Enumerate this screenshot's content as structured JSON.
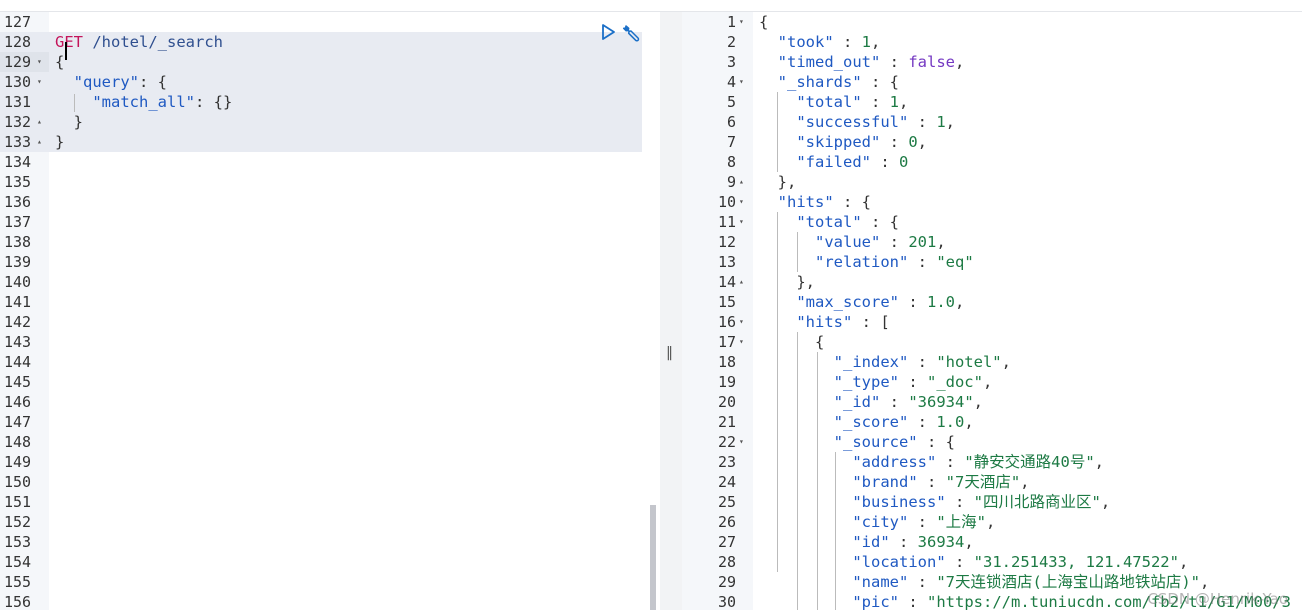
{
  "request_editor": {
    "lines": [
      {
        "n": "127",
        "html": ""
      },
      {
        "n": "128",
        "method": "GET",
        "path": "/hotel/_search"
      },
      {
        "n": "129",
        "fold": "▾",
        "code": "{",
        "tokens": [
          [
            "punc",
            "{"
          ]
        ]
      },
      {
        "n": "130",
        "fold": "▾",
        "tokens": [
          [
            "punc",
            "  "
          ],
          [
            "key",
            "\"query\""
          ],
          [
            "punc",
            ": {"
          ]
        ]
      },
      {
        "n": "131",
        "tokens": [
          [
            "punc",
            "    "
          ],
          [
            "key",
            "\"match_all\""
          ],
          [
            "punc",
            ": {}"
          ]
        ]
      },
      {
        "n": "132",
        "fold": "▴",
        "tokens": [
          [
            "punc",
            "  }"
          ]
        ]
      },
      {
        "n": "133",
        "fold": "▴",
        "tokens": [
          [
            "punc",
            "}"
          ]
        ]
      },
      {
        "n": "134"
      },
      {
        "n": "135"
      },
      {
        "n": "136"
      },
      {
        "n": "137"
      },
      {
        "n": "138"
      },
      {
        "n": "139"
      },
      {
        "n": "140"
      },
      {
        "n": "141"
      },
      {
        "n": "142"
      },
      {
        "n": "143"
      },
      {
        "n": "144"
      },
      {
        "n": "145"
      },
      {
        "n": "146"
      },
      {
        "n": "147"
      },
      {
        "n": "148"
      },
      {
        "n": "149"
      },
      {
        "n": "150"
      },
      {
        "n": "151"
      },
      {
        "n": "152"
      },
      {
        "n": "153"
      },
      {
        "n": "154"
      },
      {
        "n": "155"
      },
      {
        "n": "156"
      }
    ],
    "run_icon": "play-icon",
    "settings_icon": "wrench-icon"
  },
  "splitter": {
    "glyph": "‖"
  },
  "response_viewer": {
    "lines": [
      {
        "n": "1",
        "fold": "▾",
        "tokens": [
          [
            "punc",
            "{"
          ]
        ]
      },
      {
        "n": "2",
        "tokens": [
          [
            "punc",
            "  "
          ],
          [
            "key",
            "\"took\""
          ],
          [
            "punc",
            " : "
          ],
          [
            "num",
            "1"
          ],
          [
            "punc",
            ","
          ]
        ]
      },
      {
        "n": "3",
        "tokens": [
          [
            "punc",
            "  "
          ],
          [
            "key",
            "\"timed_out\""
          ],
          [
            "punc",
            " : "
          ],
          [
            "bool",
            "false"
          ],
          [
            "punc",
            ","
          ]
        ]
      },
      {
        "n": "4",
        "fold": "▾",
        "tokens": [
          [
            "punc",
            "  "
          ],
          [
            "key",
            "\"_shards\""
          ],
          [
            "punc",
            " : {"
          ]
        ]
      },
      {
        "n": "5",
        "tokens": [
          [
            "punc",
            "    "
          ],
          [
            "key",
            "\"total\""
          ],
          [
            "punc",
            " : "
          ],
          [
            "num",
            "1"
          ],
          [
            "punc",
            ","
          ]
        ]
      },
      {
        "n": "6",
        "tokens": [
          [
            "punc",
            "    "
          ],
          [
            "key",
            "\"successful\""
          ],
          [
            "punc",
            " : "
          ],
          [
            "num",
            "1"
          ],
          [
            "punc",
            ","
          ]
        ]
      },
      {
        "n": "7",
        "tokens": [
          [
            "punc",
            "    "
          ],
          [
            "key",
            "\"skipped\""
          ],
          [
            "punc",
            " : "
          ],
          [
            "num",
            "0"
          ],
          [
            "punc",
            ","
          ]
        ]
      },
      {
        "n": "8",
        "tokens": [
          [
            "punc",
            "    "
          ],
          [
            "key",
            "\"failed\""
          ],
          [
            "punc",
            " : "
          ],
          [
            "num",
            "0"
          ]
        ]
      },
      {
        "n": "9",
        "fold": "▴",
        "tokens": [
          [
            "punc",
            "  },"
          ]
        ]
      },
      {
        "n": "10",
        "fold": "▾",
        "tokens": [
          [
            "punc",
            "  "
          ],
          [
            "key",
            "\"hits\""
          ],
          [
            "punc",
            " : {"
          ]
        ]
      },
      {
        "n": "11",
        "fold": "▾",
        "tokens": [
          [
            "punc",
            "    "
          ],
          [
            "key",
            "\"total\""
          ],
          [
            "punc",
            " : {"
          ]
        ]
      },
      {
        "n": "12",
        "tokens": [
          [
            "punc",
            "      "
          ],
          [
            "key",
            "\"value\""
          ],
          [
            "punc",
            " : "
          ],
          [
            "num",
            "201"
          ],
          [
            "punc",
            ","
          ]
        ]
      },
      {
        "n": "13",
        "tokens": [
          [
            "punc",
            "      "
          ],
          [
            "key",
            "\"relation\""
          ],
          [
            "punc",
            " : "
          ],
          [
            "str",
            "\"eq\""
          ]
        ]
      },
      {
        "n": "14",
        "fold": "▴",
        "tokens": [
          [
            "punc",
            "    },"
          ]
        ]
      },
      {
        "n": "15",
        "tokens": [
          [
            "punc",
            "    "
          ],
          [
            "key",
            "\"max_score\""
          ],
          [
            "punc",
            " : "
          ],
          [
            "num",
            "1.0"
          ],
          [
            "punc",
            ","
          ]
        ]
      },
      {
        "n": "16",
        "fold": "▾",
        "tokens": [
          [
            "punc",
            "    "
          ],
          [
            "key",
            "\"hits\""
          ],
          [
            "punc",
            " : ["
          ]
        ]
      },
      {
        "n": "17",
        "fold": "▾",
        "tokens": [
          [
            "punc",
            "      {"
          ]
        ]
      },
      {
        "n": "18",
        "tokens": [
          [
            "punc",
            "        "
          ],
          [
            "key",
            "\"_index\""
          ],
          [
            "punc",
            " : "
          ],
          [
            "str",
            "\"hotel\""
          ],
          [
            "punc",
            ","
          ]
        ]
      },
      {
        "n": "19",
        "tokens": [
          [
            "punc",
            "        "
          ],
          [
            "key",
            "\"_type\""
          ],
          [
            "punc",
            " : "
          ],
          [
            "str",
            "\"_doc\""
          ],
          [
            "punc",
            ","
          ]
        ]
      },
      {
        "n": "20",
        "tokens": [
          [
            "punc",
            "        "
          ],
          [
            "key",
            "\"_id\""
          ],
          [
            "punc",
            " : "
          ],
          [
            "str",
            "\"36934\""
          ],
          [
            "punc",
            ","
          ]
        ]
      },
      {
        "n": "21",
        "tokens": [
          [
            "punc",
            "        "
          ],
          [
            "key",
            "\"_score\""
          ],
          [
            "punc",
            " : "
          ],
          [
            "num",
            "1.0"
          ],
          [
            "punc",
            ","
          ]
        ]
      },
      {
        "n": "22",
        "fold": "▾",
        "tokens": [
          [
            "punc",
            "        "
          ],
          [
            "key",
            "\"_source\""
          ],
          [
            "punc",
            " : {"
          ]
        ]
      },
      {
        "n": "23",
        "tokens": [
          [
            "punc",
            "          "
          ],
          [
            "key",
            "\"address\""
          ],
          [
            "punc",
            " : "
          ],
          [
            "str",
            "\"静安交通路40号\""
          ],
          [
            "punc",
            ","
          ]
        ]
      },
      {
        "n": "24",
        "tokens": [
          [
            "punc",
            "          "
          ],
          [
            "key",
            "\"brand\""
          ],
          [
            "punc",
            " : "
          ],
          [
            "str",
            "\"7天酒店\""
          ],
          [
            "punc",
            ","
          ]
        ]
      },
      {
        "n": "25",
        "tokens": [
          [
            "punc",
            "          "
          ],
          [
            "key",
            "\"business\""
          ],
          [
            "punc",
            " : "
          ],
          [
            "str",
            "\"四川北路商业区\""
          ],
          [
            "punc",
            ","
          ]
        ]
      },
      {
        "n": "26",
        "tokens": [
          [
            "punc",
            "          "
          ],
          [
            "key",
            "\"city\""
          ],
          [
            "punc",
            " : "
          ],
          [
            "str",
            "\"上海\""
          ],
          [
            "punc",
            ","
          ]
        ]
      },
      {
        "n": "27",
        "tokens": [
          [
            "punc",
            "          "
          ],
          [
            "key",
            "\"id\""
          ],
          [
            "punc",
            " : "
          ],
          [
            "num",
            "36934"
          ],
          [
            "punc",
            ","
          ]
        ]
      },
      {
        "n": "28",
        "tokens": [
          [
            "punc",
            "          "
          ],
          [
            "key",
            "\"location\""
          ],
          [
            "punc",
            " : "
          ],
          [
            "str",
            "\"31.251433, 121.47522\""
          ],
          [
            "punc",
            ","
          ]
        ]
      },
      {
        "n": "29",
        "tokens": [
          [
            "punc",
            "          "
          ],
          [
            "key",
            "\"name\""
          ],
          [
            "punc",
            " : "
          ],
          [
            "str",
            "\"7天连锁酒店(上海宝山路地铁站店)\""
          ],
          [
            "punc",
            ","
          ]
        ]
      },
      {
        "n": "30",
        "tokens": [
          [
            "punc",
            "          "
          ],
          [
            "key",
            "\"pic\""
          ],
          [
            "punc",
            " : "
          ],
          [
            "str",
            "\"https://m.tuniucdn.com/fb2/t1/G1/M00/3"
          ]
        ]
      }
    ]
  },
  "watermark": "CSDN @Henrik-Yao",
  "colors": {
    "key": "#1f59c2",
    "string": "#1d7a44",
    "bool": "#7438c2",
    "method": "#c4145a",
    "gutter": "#f5f7fa",
    "request_highlight": "#e8ebf2"
  }
}
